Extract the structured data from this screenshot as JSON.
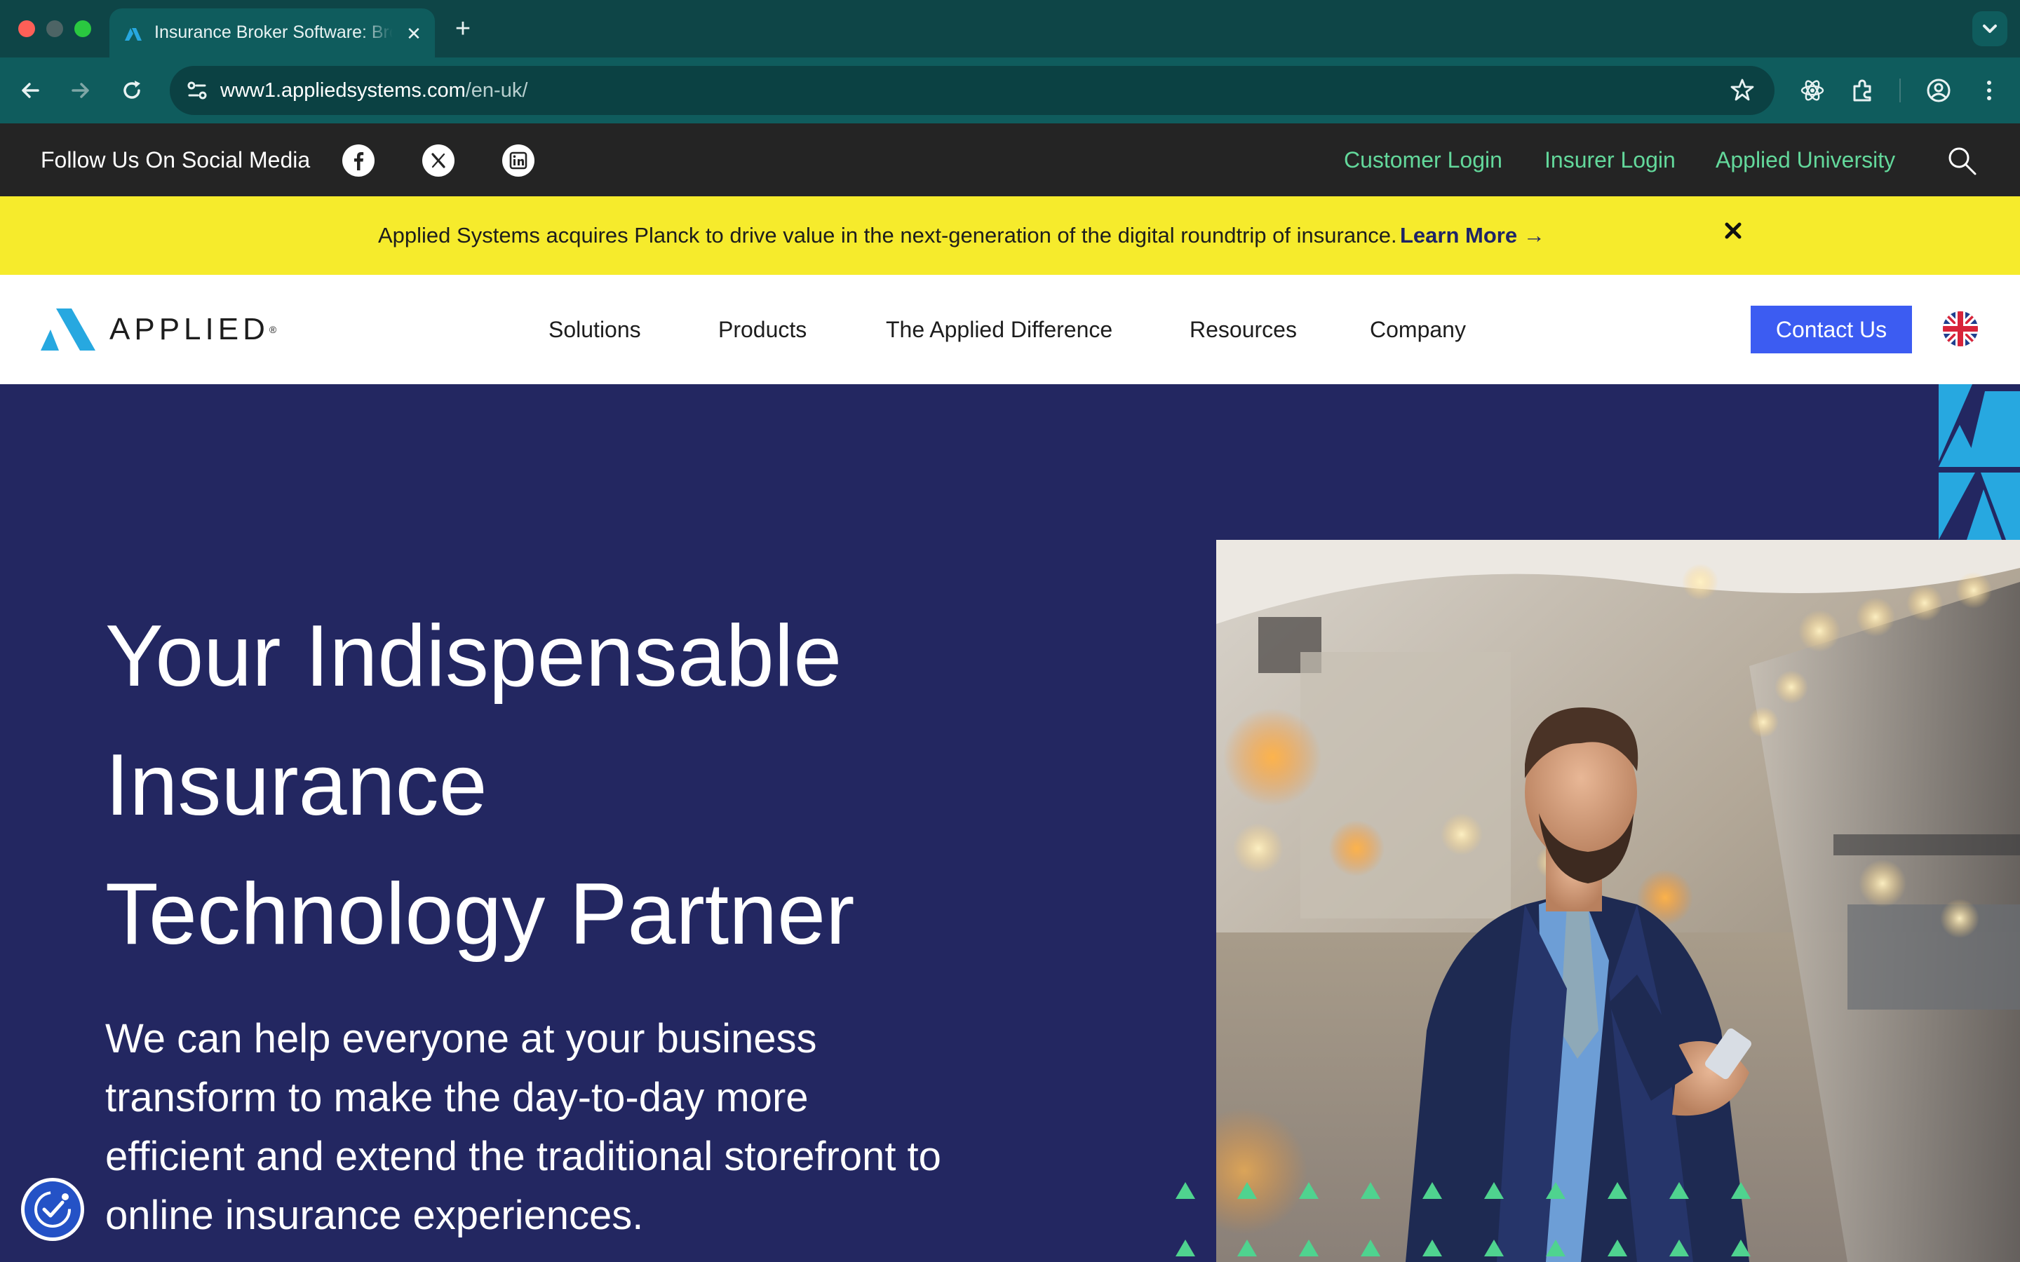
{
  "browser": {
    "tab_title": "Insurance Broker Software: Broker Management Systems",
    "tab_close_glyph": "✕",
    "new_tab_glyph": "+",
    "url_host": "www1.appliedsystems.com",
    "url_path": "/en-uk/"
  },
  "utility_bar": {
    "social_label": "Follow Us On Social Media",
    "social_icons": [
      "facebook-icon",
      "x-icon",
      "linkedin-icon"
    ],
    "links": {
      "customer_login": "Customer Login",
      "insurer_login": "Insurer Login",
      "applied_university": "Applied University"
    },
    "link_color": "#63d89b"
  },
  "announcement": {
    "text": "Applied Systems acquires Planck to drive value in the next-generation of the digital roundtrip of insurance.",
    "link": "Learn More →",
    "background": "#f6eb2c"
  },
  "nav": {
    "logo_text": "APPLIED",
    "logo_trademark": "®",
    "items": {
      "solutions": "Solutions",
      "products": "Products",
      "difference": "The Applied Difference",
      "resources": "Resources",
      "company": "Company"
    },
    "contact_label": "Contact Us",
    "contact_color": "#3c5cf2",
    "language_icon": "uk-flag-icon"
  },
  "hero": {
    "heading_lines": [
      "Your Indispensable",
      "Insurance",
      "Technology Partner"
    ],
    "body": "We can help everyone at your business transform to make the day-to-day more efficient and extend the traditional storefront to online insurance experiences.",
    "background": "#232761",
    "photo": "man-in-suit-using-phone-on-train-platform"
  }
}
